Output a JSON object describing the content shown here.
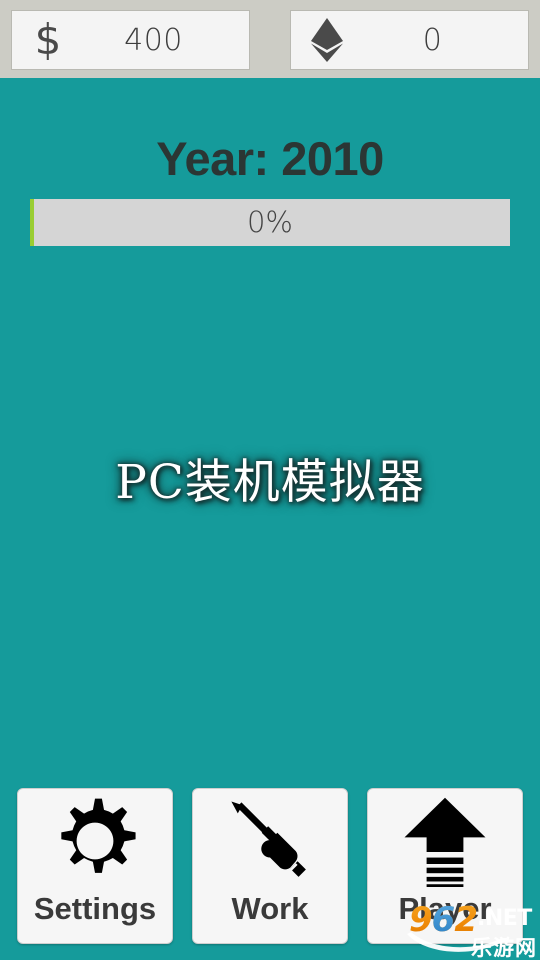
{
  "app": {
    "title": "PC装机模拟器",
    "background_color": "#159b9b"
  },
  "topbar": {
    "background_color": "#ccccc5",
    "money": {
      "icon": "dollar-sign-icon",
      "glyph": "$",
      "value": "400"
    },
    "crypto": {
      "icon": "ethereum-icon",
      "value": "0"
    }
  },
  "status": {
    "year_label": "Year: 2010",
    "year_value": "2010"
  },
  "progress": {
    "label": "0%",
    "percent": 0,
    "fill_color": "#9acd32",
    "track_color": "#d5d5d5"
  },
  "buttons": [
    {
      "id": "settings",
      "label": "Settings",
      "icon": "gear-icon"
    },
    {
      "id": "work",
      "label": "Work",
      "icon": "screwdriver-icon"
    },
    {
      "id": "player",
      "label": "Player",
      "icon": "upload-arrow-icon"
    }
  ],
  "watermark": {
    "number": "962",
    "number_prefix": "9",
    "number_middle": "6",
    "number_suffix": "2",
    "domain": ".NET",
    "site_cn": "乐游网"
  }
}
